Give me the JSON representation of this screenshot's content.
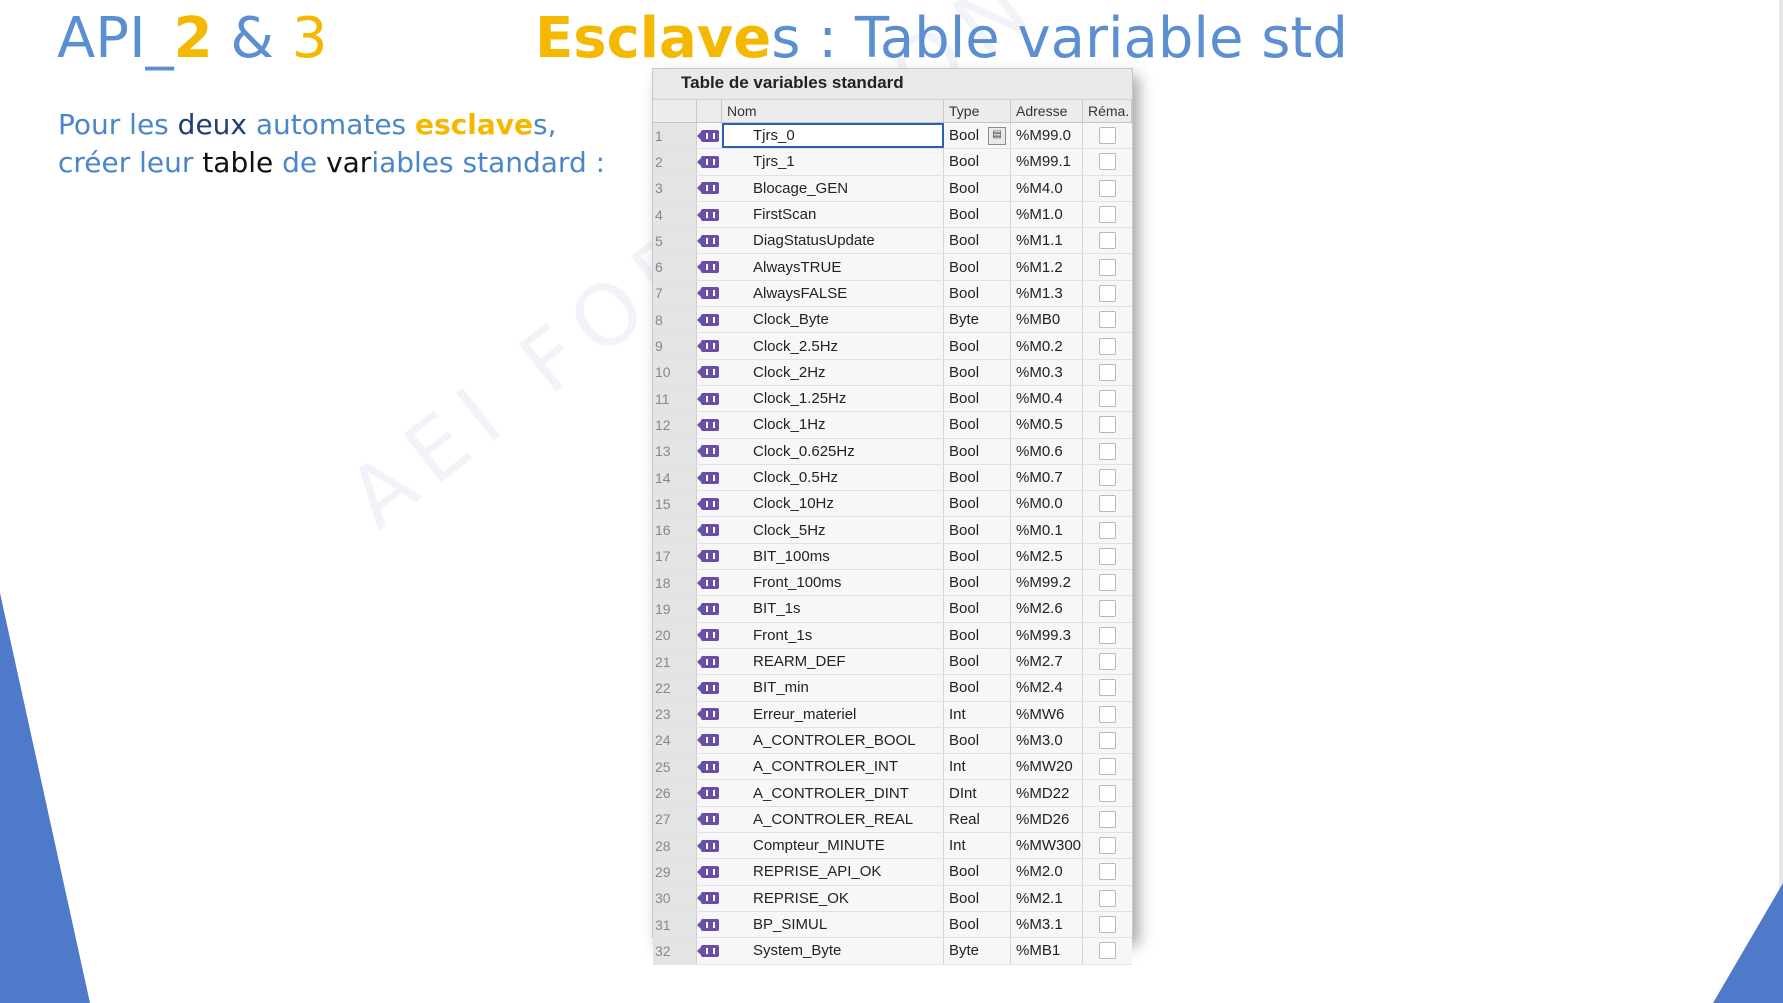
{
  "title_left": {
    "prefix": "API_",
    "num2": "2",
    "amp": " & ",
    "num3": "3"
  },
  "title_main": {
    "highlight": "Esclave",
    "s": "s",
    "rest": " : Table variable std"
  },
  "description": {
    "l1a": "Pour les ",
    "l1b": "deux",
    "l1c": " automates ",
    "l1d": "esclave",
    "l1e": "s,",
    "l2a": "créer leur ",
    "l2b": "table",
    "l2c": " de ",
    "l2d": "var",
    "l2e": "iables standard :"
  },
  "watermark": "AEI FORMATION OUEST",
  "panel": {
    "title": "Table de variables standard",
    "columns": {
      "name": "Nom",
      "type": "Type",
      "address": "Adresse",
      "retain": "Réma."
    },
    "dropdown_glyph": "▤",
    "rows": [
      {
        "num": "1",
        "name": "Tjrs_0",
        "type": "Bool",
        "address": "%M99.0"
      },
      {
        "num": "2",
        "name": "Tjrs_1",
        "type": "Bool",
        "address": "%M99.1"
      },
      {
        "num": "3",
        "name": "Blocage_GEN",
        "type": "Bool",
        "address": "%M4.0"
      },
      {
        "num": "4",
        "name": "FirstScan",
        "type": "Bool",
        "address": "%M1.0"
      },
      {
        "num": "5",
        "name": "DiagStatusUpdate",
        "type": "Bool",
        "address": "%M1.1"
      },
      {
        "num": "6",
        "name": "AlwaysTRUE",
        "type": "Bool",
        "address": "%M1.2"
      },
      {
        "num": "7",
        "name": "AlwaysFALSE",
        "type": "Bool",
        "address": "%M1.3"
      },
      {
        "num": "8",
        "name": "Clock_Byte",
        "type": "Byte",
        "address": "%MB0"
      },
      {
        "num": "9",
        "name": "Clock_2.5Hz",
        "type": "Bool",
        "address": "%M0.2"
      },
      {
        "num": "10",
        "name": "Clock_2Hz",
        "type": "Bool",
        "address": "%M0.3"
      },
      {
        "num": "11",
        "name": "Clock_1.25Hz",
        "type": "Bool",
        "address": "%M0.4"
      },
      {
        "num": "12",
        "name": "Clock_1Hz",
        "type": "Bool",
        "address": "%M0.5"
      },
      {
        "num": "13",
        "name": "Clock_0.625Hz",
        "type": "Bool",
        "address": "%M0.6"
      },
      {
        "num": "14",
        "name": "Clock_0.5Hz",
        "type": "Bool",
        "address": "%M0.7"
      },
      {
        "num": "15",
        "name": "Clock_10Hz",
        "type": "Bool",
        "address": "%M0.0"
      },
      {
        "num": "16",
        "name": "Clock_5Hz",
        "type": "Bool",
        "address": "%M0.1"
      },
      {
        "num": "17",
        "name": "BIT_100ms",
        "type": "Bool",
        "address": "%M2.5"
      },
      {
        "num": "18",
        "name": "Front_100ms",
        "type": "Bool",
        "address": "%M99.2"
      },
      {
        "num": "19",
        "name": "BIT_1s",
        "type": "Bool",
        "address": "%M2.6"
      },
      {
        "num": "20",
        "name": "Front_1s",
        "type": "Bool",
        "address": "%M99.3"
      },
      {
        "num": "21",
        "name": "REARM_DEF",
        "type": "Bool",
        "address": "%M2.7"
      },
      {
        "num": "22",
        "name": "BIT_min",
        "type": "Bool",
        "address": "%M2.4"
      },
      {
        "num": "23",
        "name": "Erreur_materiel",
        "type": "Int",
        "address": "%MW6"
      },
      {
        "num": "24",
        "name": "A_CONTROLER_BOOL",
        "type": "Bool",
        "address": "%M3.0"
      },
      {
        "num": "25",
        "name": "A_CONTROLER_INT",
        "type": "Int",
        "address": "%MW20"
      },
      {
        "num": "26",
        "name": "A_CONTROLER_DINT",
        "type": "DInt",
        "address": "%MD22"
      },
      {
        "num": "27",
        "name": "A_CONTROLER_REAL",
        "type": "Real",
        "address": "%MD26"
      },
      {
        "num": "28",
        "name": "Compteur_MINUTE",
        "type": "Int",
        "address": "%MW300"
      },
      {
        "num": "29",
        "name": "REPRISE_API_OK",
        "type": "Bool",
        "address": "%M2.0"
      },
      {
        "num": "30",
        "name": "REPRISE_OK",
        "type": "Bool",
        "address": "%M2.1"
      },
      {
        "num": "31",
        "name": "BP_SIMUL",
        "type": "Bool",
        "address": "%M3.1"
      },
      {
        "num": "32",
        "name": "System_Byte",
        "type": "Byte",
        "address": "%MB1"
      }
    ]
  }
}
